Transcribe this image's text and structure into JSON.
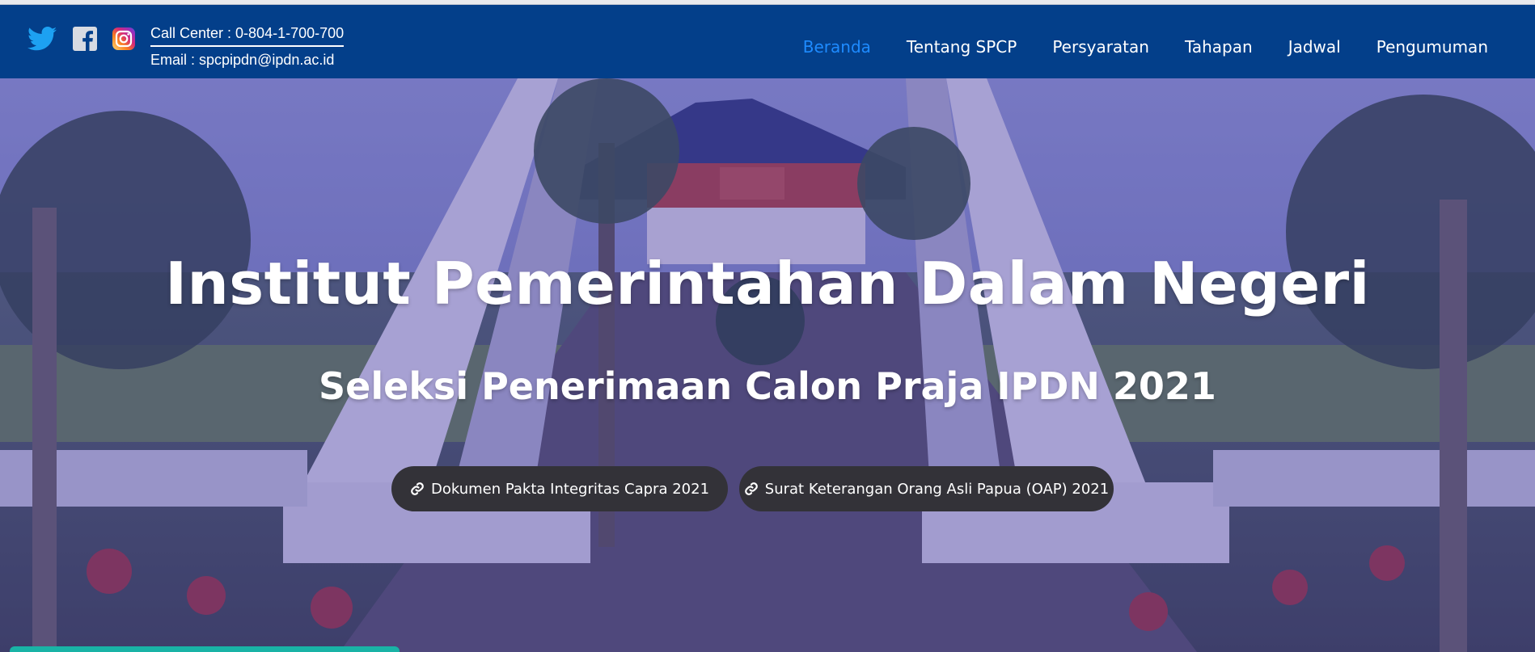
{
  "header": {
    "social": [
      {
        "icon": "twitter-icon",
        "color": "#1da1f2"
      },
      {
        "icon": "facebook-icon",
        "color": "#ffffff"
      },
      {
        "icon": "instagram-icon",
        "color": "#e1306c"
      }
    ],
    "call_center": "Call Center : 0-804-1-700-700",
    "email": "Email : spcpipdn@ipdn.ac.id",
    "nav": [
      {
        "label": "Beranda",
        "active": true
      },
      {
        "label": "Tentang SPCP",
        "active": false
      },
      {
        "label": "Persyaratan",
        "active": false
      },
      {
        "label": "Tahapan",
        "active": false
      },
      {
        "label": "Jadwal",
        "active": false
      },
      {
        "label": "Pengumuman",
        "active": false
      }
    ]
  },
  "hero": {
    "title": "Institut Pemerintahan Dalam Negeri",
    "subtitle": "Seleksi Penerimaan Calon Praja IPDN 2021",
    "buttons": [
      {
        "label": "Dokumen Pakta Integritas Capra 2021",
        "icon": "link-icon"
      },
      {
        "label": "Surat Keterangan Orang Asli Papua (OAP) 2021",
        "icon": "link-icon"
      }
    ]
  },
  "colors": {
    "navbar": "#033f8a",
    "active_nav": "#1e8bff",
    "button_bg": "#333238",
    "overlay": "#3e2ca0"
  }
}
